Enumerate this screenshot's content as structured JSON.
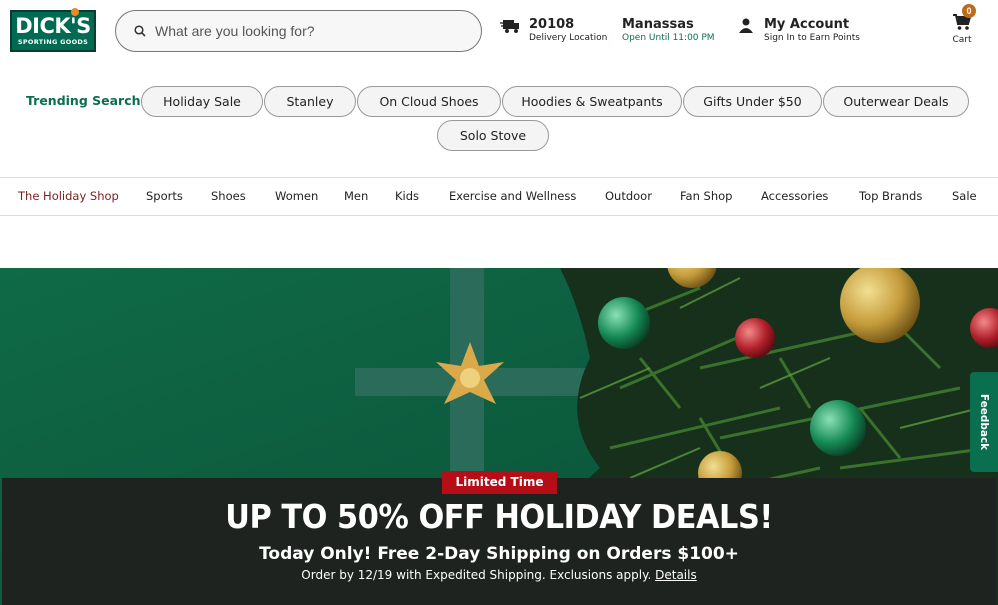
{
  "brand": {
    "logo_main": "DICK'S",
    "logo_sub": "SPORTING GOODS"
  },
  "search": {
    "placeholder": "What are you looking for?"
  },
  "header": {
    "delivery": {
      "zip": "20108",
      "label": "Delivery Location"
    },
    "store": {
      "name": "Manassas",
      "hours": "Open Until 11:00 PM"
    },
    "account": {
      "title": "My Account",
      "subtitle": "Sign In to Earn Points"
    },
    "cart": {
      "label": "Cart",
      "count": "0"
    }
  },
  "trending": {
    "label": "Trending Searches",
    "items": [
      "Holiday Sale",
      "Stanley",
      "On Cloud Shoes",
      "Hoodies & Sweatpants",
      "Gifts Under $50",
      "Outerwear Deals",
      "Solo Stove"
    ]
  },
  "nav": {
    "items": [
      "The Holiday Shop",
      "Sports",
      "Shoes",
      "Women",
      "Men",
      "Kids",
      "Exercise and Wellness",
      "Outdoor",
      "Fan Shop",
      "Accessories",
      "Top Brands",
      "Sale"
    ]
  },
  "promo": {
    "badge": "Limited Time",
    "headline": "UP TO 50% OFF HOLIDAY DEALS!",
    "sub1": "Today Only! Free 2-Day Shipping on Orders $100+",
    "sub2": "Order by 12/19 with Expedited Shipping. Exclusions apply.",
    "details_link": "Details"
  },
  "feedback": {
    "label": "Feedback"
  },
  "colors": {
    "brand_green": "#006a52",
    "accent_green": "#0a6f4f",
    "promo_red": "#b60e17",
    "promo_bg": "#1e2320"
  }
}
